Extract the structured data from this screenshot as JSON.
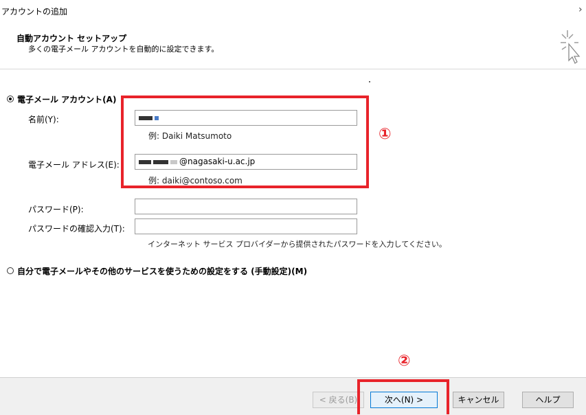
{
  "window": {
    "title": "アカウントの追加",
    "close": "›"
  },
  "header": {
    "title": "自動アカウント セットアップ",
    "subtitle": "多くの電子メール アカウントを自動的に設定できます。"
  },
  "auto_option": {
    "label": "電子メール アカウント(A)",
    "selected": true
  },
  "fields": {
    "name": {
      "label": "名前(Y):",
      "value_suffix": "",
      "hint": "例: Daiki Matsumoto"
    },
    "email": {
      "label": "電子メール アドレス(E):",
      "value_suffix": "@nagasaki-u.ac.jp",
      "hint": "例: daiki@contoso.com"
    },
    "password": {
      "label": "パスワード(P):",
      "value": ""
    },
    "password_confirm": {
      "label": "パスワードの確認入力(T):",
      "value": ""
    },
    "password_hint": "インターネット サービス プロバイダーから提供されたパスワードを入力してください。"
  },
  "manual_option": {
    "label": "自分で電子メールやその他のサービスを使うための設定をする (手動設定)(M)",
    "selected": false
  },
  "annotations": {
    "one": "①",
    "two": "②",
    "color": "#e8232a"
  },
  "buttons": {
    "back": "< 戻る(B)",
    "next": "次へ(N) >",
    "cancel": "キャンセル",
    "help": "ヘルプ"
  }
}
